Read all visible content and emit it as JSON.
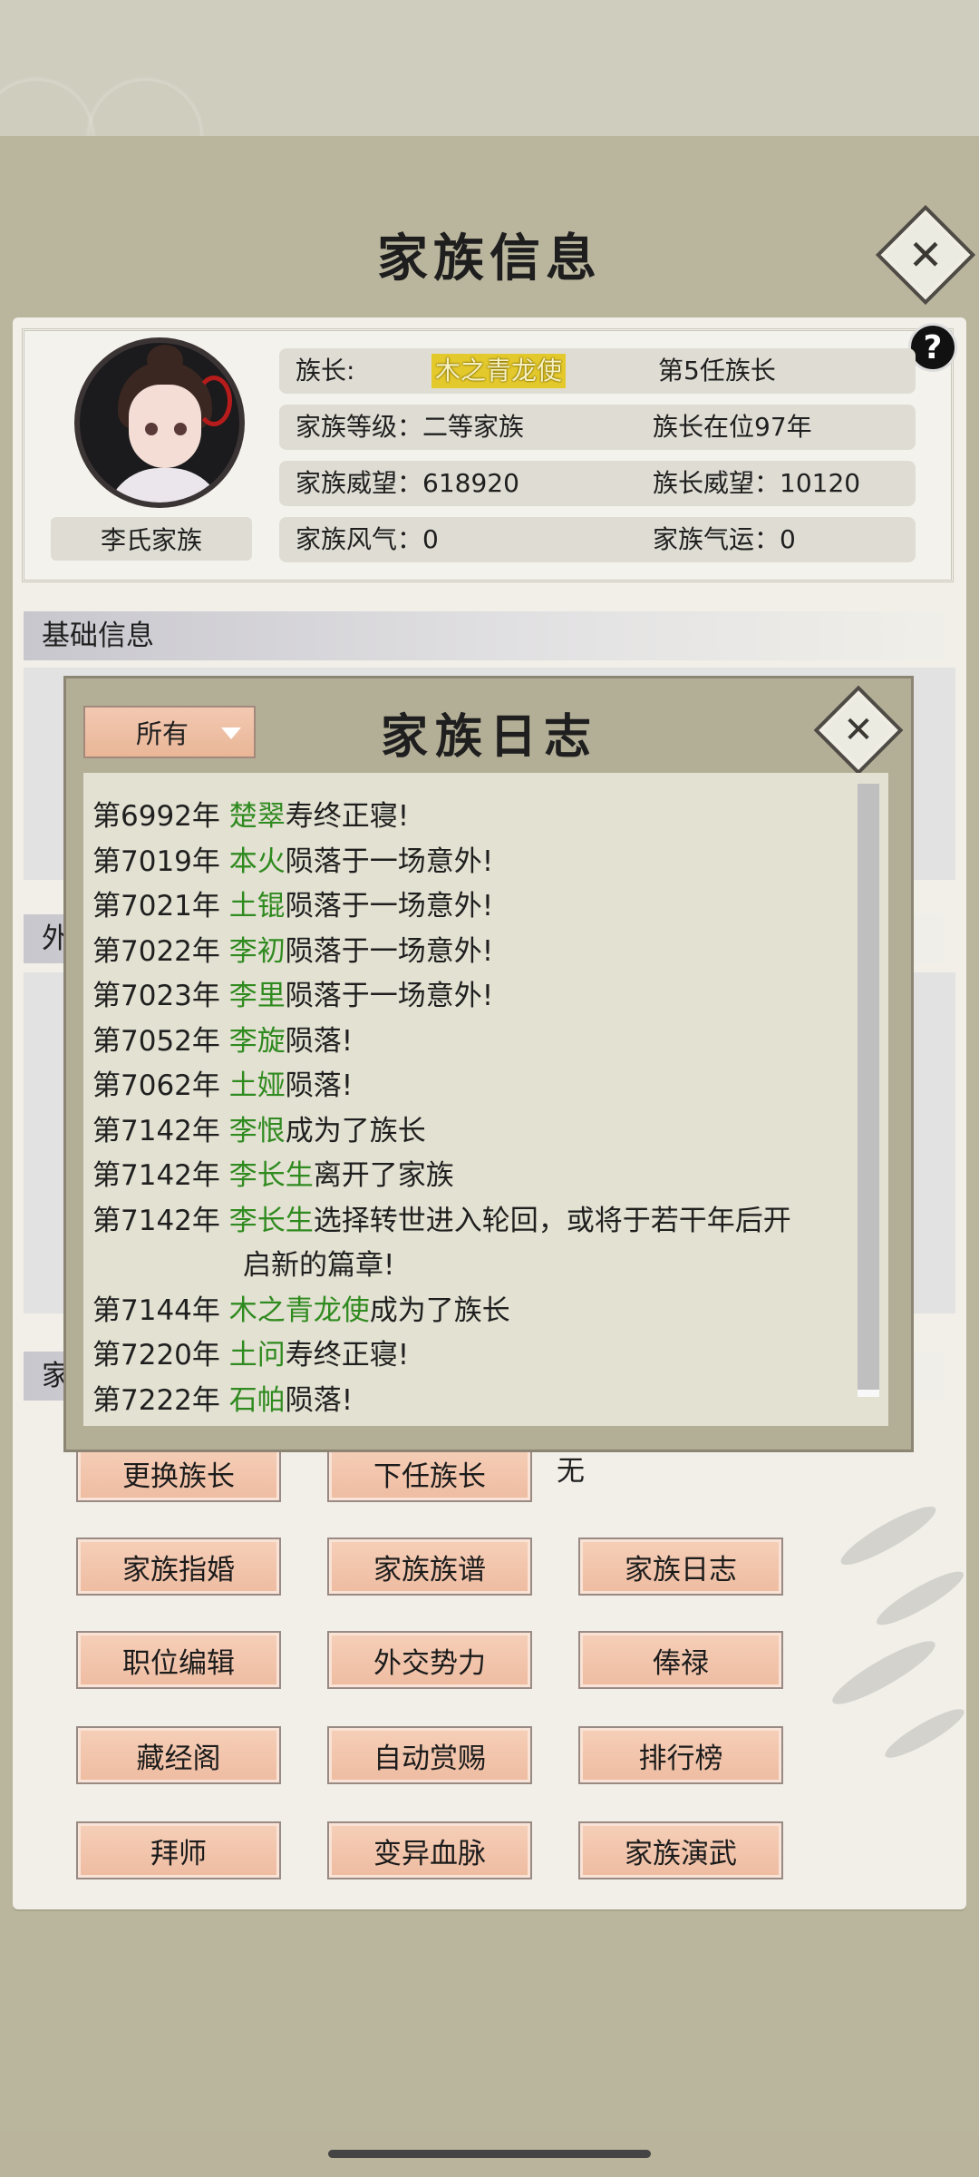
{
  "window": {
    "title": "家族信息"
  },
  "family": {
    "name": "李氏家族",
    "leader_label": "族长:",
    "leader_name": "木之青龙使",
    "leader_rank": "第5任族长",
    "level": "家族等级：二等家族",
    "tenure": "族长在位97年",
    "prestige": "家族威望：618920",
    "leader_prestige": "族长威望：10120",
    "culture": "家族风气：0",
    "fortune": "家族气运：0"
  },
  "sections": {
    "basic": "基础信息",
    "foreign_fragment": "外",
    "family_fragment": "家"
  },
  "actions": {
    "next_leader_value": "无",
    "buttons": [
      "更换族长",
      "下任族长",
      "家族指婚",
      "家族族谱",
      "家族日志",
      "职位编辑",
      "外交势力",
      "俸禄",
      "藏经阁",
      "自动赏赐",
      "排行榜",
      "拜师",
      "变异血脉",
      "家族演武"
    ]
  },
  "log_dialog": {
    "title": "家族日志",
    "filter": "所有",
    "entries": [
      {
        "year": "第6992年",
        "name": "楚翠",
        "text": "寿终正寝!"
      },
      {
        "year": "第7019年",
        "name": "本火",
        "text": "陨落于一场意外!"
      },
      {
        "year": "第7021年",
        "name": "土锟",
        "text": "陨落于一场意外!"
      },
      {
        "year": "第7022年",
        "name": "李初",
        "text": "陨落于一场意外!"
      },
      {
        "year": "第7023年",
        "name": "李里",
        "text": "陨落于一场意外!"
      },
      {
        "year": "第7052年",
        "name": "李旋",
        "text": "陨落!"
      },
      {
        "year": "第7062年",
        "name": "土娅",
        "text": "陨落!"
      },
      {
        "year": "第7142年",
        "name": "李恨",
        "text": "成为了族长"
      },
      {
        "year": "第7142年",
        "name": "李长生",
        "text": "离开了家族"
      },
      {
        "year": "第7142年",
        "name": "李长生",
        "text": "选择转世进入轮回，或将于若干年后开",
        "cont": "启新的篇章!"
      },
      {
        "year": "第7144年",
        "name": "木之青龙使",
        "text": "成为了族长"
      },
      {
        "year": "第7220年",
        "name": "土问",
        "text": "寿终正寝!"
      },
      {
        "year": "第7222年",
        "name": "石帕",
        "text": "陨落!"
      }
    ]
  },
  "colors": {
    "name_green": "#2f8a1f",
    "leader_highlight": "#e4c92c",
    "button": "#f3c5ad"
  }
}
